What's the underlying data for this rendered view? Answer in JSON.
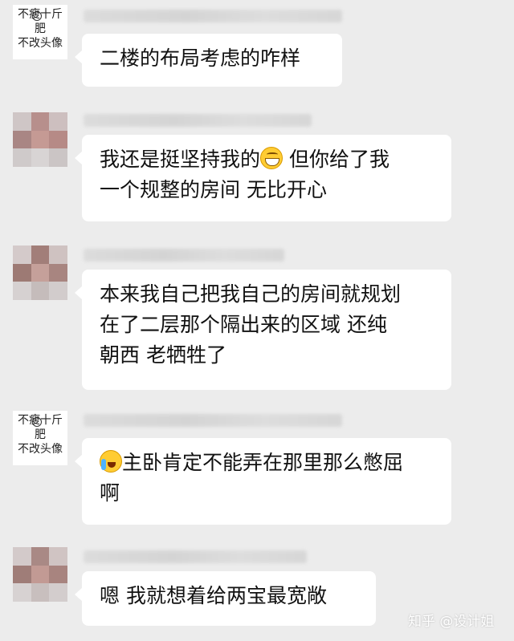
{
  "messages": [
    {
      "avatar_lines": [
        "不瘦十斤",
        "肥",
        "不改头像"
      ],
      "text": "二楼的布局考虑的咋样"
    },
    {
      "text_a": "我还是挺坚持我的",
      "emoji": "grinning-face-emoji",
      "text_b": " 但你给了我",
      "text_c": "一个规整的房间 无比开心"
    },
    {
      "lines": [
        "本来我自己把我自己的房间就规划",
        "在了二层那个隔出来的区域  还纯",
        "朝西  老牺牲了"
      ]
    },
    {
      "avatar_lines": [
        "不瘦十斤",
        "肥",
        "不改头像"
      ],
      "emoji": "crying-face-emoji",
      "line1": "主卧肯定不能弄在那里那么憋屈",
      "line2": "啊"
    },
    {
      "text": "嗯  我就想着给两宝最宽敞"
    }
  ],
  "watermark": "知乎 @设计姐"
}
